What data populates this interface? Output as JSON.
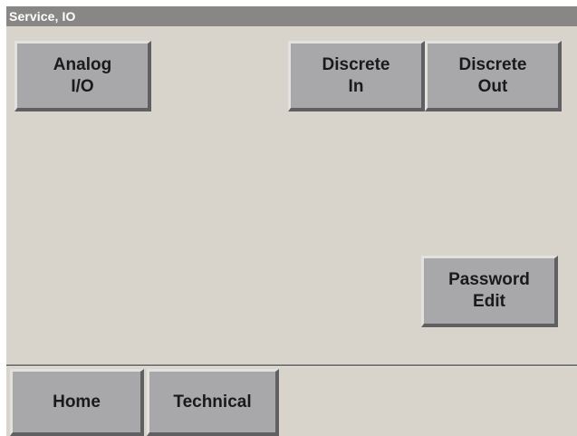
{
  "title_bar": {
    "title": "Service, IO"
  },
  "buttons": {
    "analog_io": {
      "line1": "Analog",
      "line2": "I/O"
    },
    "discrete_in": {
      "line1": "Discrete",
      "line2": "In"
    },
    "discrete_out": {
      "line1": "Discrete",
      "line2": "Out"
    },
    "password_edit": {
      "line1": "Password",
      "line2": "Edit"
    }
  },
  "footer": {
    "home": "Home",
    "technical": "Technical"
  },
  "colors": {
    "background": "#d8d4cc",
    "title_bar": "#888785",
    "button_face": "#a8a8aa",
    "button_highlight": "#e2e1de",
    "button_shadow": "#606062"
  }
}
